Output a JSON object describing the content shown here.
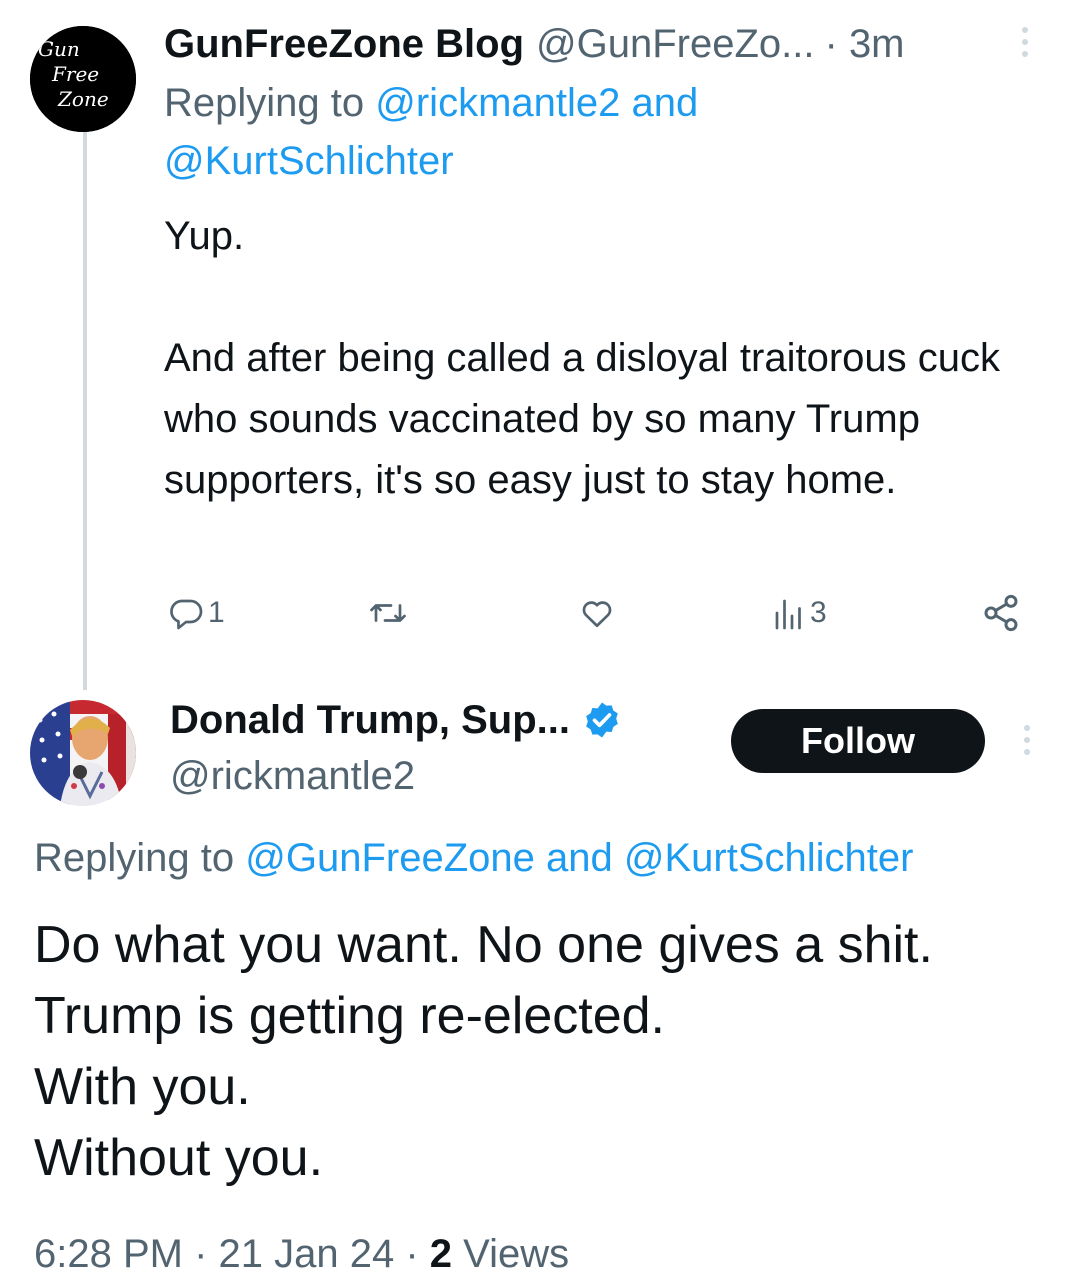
{
  "tweet1": {
    "avatar_text": [
      "Gun",
      "Free",
      "Zone"
    ],
    "name": "GunFreeZone Blog",
    "handle": "@GunFreeZo...",
    "separator": "·",
    "time": "3m",
    "reply_prefix": "Replying to",
    "reply_mention1": "@rickmantle2",
    "reply_and": "and",
    "reply_mention2": "@KurtSchlichter",
    "body_line1": "Yup.",
    "body_para2": "And after being called a disloyal traitorous cuck who sounds vaccinated by so many Trump supporters, it's so easy just to stay home.",
    "reply_count": "1",
    "views_count": "3",
    "icons": [
      "reply-icon",
      "retweet-icon",
      "like-icon",
      "views-icon",
      "share-icon",
      "more-icon"
    ]
  },
  "tweet2": {
    "name": "Donald Trump, Sup...",
    "handle": "@rickmantle2",
    "follow_label": "Follow",
    "reply_prefix": "Replying to",
    "reply_mention1": "@GunFreeZone",
    "reply_and": "and",
    "reply_mention2": "@KurtSchlichter",
    "body_lines": [
      "Do what you want. No one gives a shit.",
      "Trump is getting re-elected.",
      "With you.",
      "Without you."
    ],
    "time": "6:28 PM",
    "date": "21 Jan 24",
    "views_count": "2",
    "views_label": "Views"
  },
  "colors": {
    "text": "#0f1419",
    "muted": "#536471",
    "link": "#1d9bf0",
    "verified": "#1d9bf0",
    "thread_line": "#cfd9de"
  }
}
